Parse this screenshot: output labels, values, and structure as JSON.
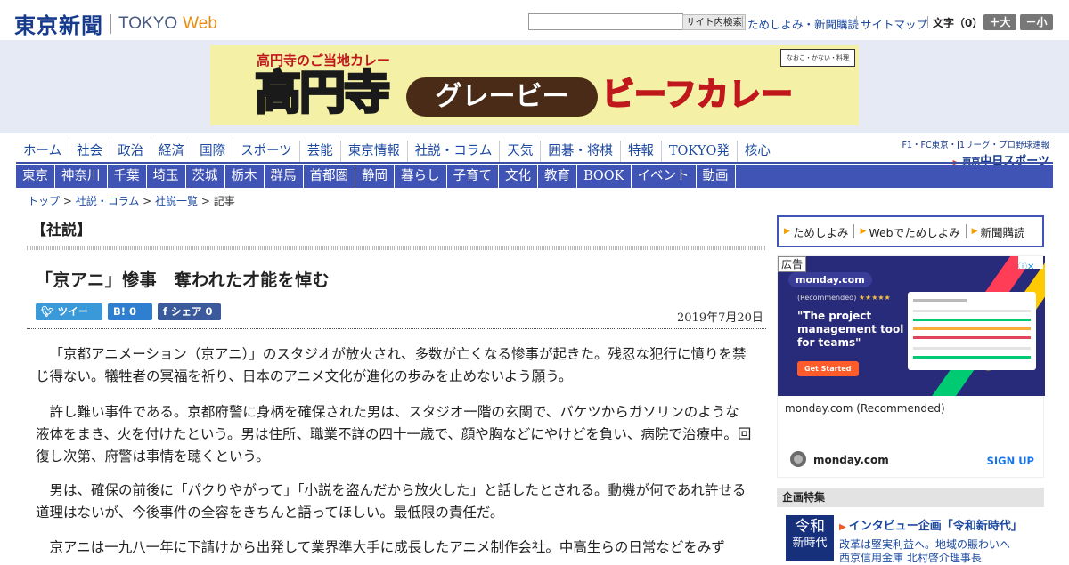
{
  "header": {
    "logo_jp": "東京新聞",
    "logo_en_tokyo": "TOKYO",
    "logo_en_web": "Web",
    "search_button": "サイト内検索",
    "links": [
      "ためしよみ・新聞購読",
      "サイトマップ"
    ],
    "font_size_label": "文字（0）",
    "font_bigger": "＋大",
    "font_smaller": "－小"
  },
  "banner": {
    "subtitle": "高円寺のご当地カレー",
    "big": "高円寺",
    "pill": "グレービー",
    "curry": "ビーフカレー",
    "badge": "なおこ・かない・料理"
  },
  "nav_primary": [
    "ホーム",
    "社会",
    "政治",
    "経済",
    "国際",
    "スポーツ",
    "芸能",
    "東京情報",
    "社説・コラム",
    "天気",
    "囲碁・将棋",
    "特報",
    "TOKYO発",
    "核心"
  ],
  "chunichi": {
    "top": "F1・FC東京・J1リーグ・プロ野球速報",
    "prefix": "東京",
    "name": "中日スポーツ"
  },
  "nav_secondary": [
    "東京",
    "神奈川",
    "千葉",
    "埼玉",
    "茨城",
    "栃木",
    "群馬",
    "首都圏",
    "静岡",
    "暮らし",
    "子育て",
    "文化",
    "教育",
    "BOOK",
    "イベント",
    "動画"
  ],
  "breadcrumb": {
    "top": "トップ",
    "sep": " > ",
    "category": "社説・コラム",
    "list": "社説一覧",
    "current": "記事"
  },
  "article": {
    "section": "【社説】",
    "headline": "「京アニ」惨事　奪われた才能を悼む",
    "tweet_label": "ツイート",
    "hatena_label": "B!",
    "hatena_count": "0",
    "share_label": "シェア",
    "share_count": "0",
    "date": "2019年7月20日",
    "paragraphs": [
      "「京都アニメーション（京アニ）」のスタジオが放火され、多数が亡くなる惨事が起きた。残忍な犯行に憤りを禁じ得ない。犠牲者の冥福を祈り、日本のアニメ文化が進化の歩みを止めないよう願う。",
      "許し難い事件である。京都府警に身柄を確保された男は、スタジオ一階の玄関で、バケツからガソリンのような液体をまき、火を付けたという。男は住所、職業不詳の四十一歳で、顔や胸などにやけどを負い、病院で治療中。回復し次第、府警は事情を聴くという。",
      "男は、確保の前後に「パクりやがって」「小説を盗んだから放火した」と話したとされる。動機が何であれ許せる道理はないが、今後事件の全容をきちんと語ってほしい。最低限の責任だ。",
      "京アニは一九八一年に下請けから出発して業界準大手に成長したアニメ制作会社。中高生らの日常などをみず"
    ]
  },
  "sidebar": {
    "subscribe": [
      "ためしよみ",
      "Webでためしよみ",
      "新聞購読"
    ],
    "ad": {
      "label": "広告",
      "brand": "monday.com",
      "recommended": "(Recommended)",
      "quote": "\"The project management tool for teams\"",
      "cta": "Get Started",
      "caption": "monday.com (Recommended)",
      "domain": "monday.com",
      "signup": "SIGN UP"
    },
    "feature": {
      "header": "企画特集",
      "thumb_line1": "令和",
      "thumb_line2": "新時代",
      "title": "インタビュー企画「令和新時代」",
      "sub_line1": "改革は堅実利益へ。地域の賑わいへ",
      "sub_line2": "西京信用金庫 北村啓介理事長"
    }
  }
}
